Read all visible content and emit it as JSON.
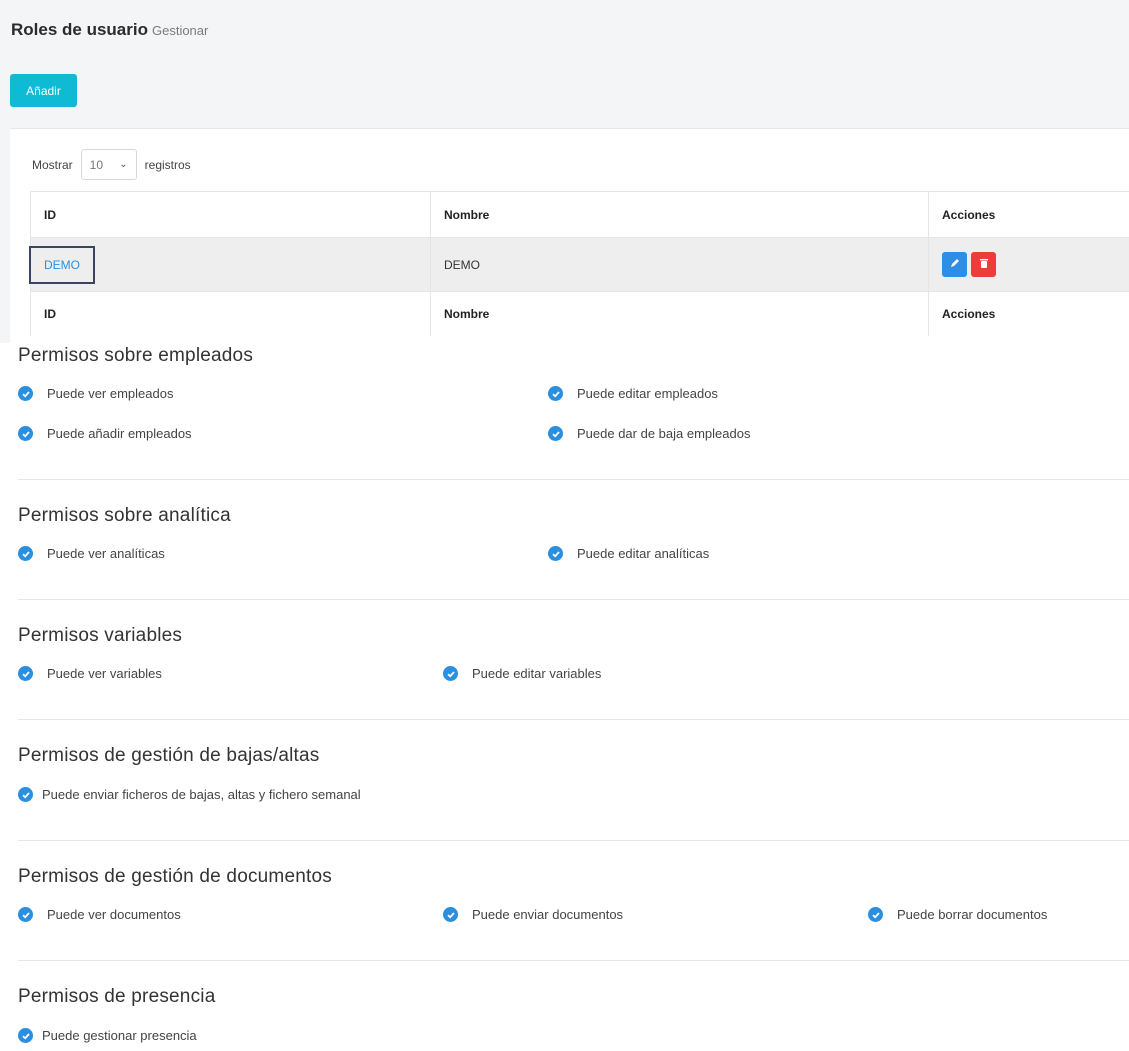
{
  "header": {
    "title": "Roles de usuario",
    "subtitle": "Gestionar"
  },
  "toolbar": {
    "add_label": "Añadir"
  },
  "table": {
    "length_prefix": "Mostrar",
    "length_value": "10",
    "length_suffix": "registros",
    "columns": [
      "ID",
      "Nombre",
      "Acciones"
    ],
    "rows": [
      {
        "id": "DEMO",
        "name": "DEMO"
      }
    ]
  },
  "sections": [
    {
      "title": "Permisos sobre empleados",
      "items": [
        "Puede ver empleados",
        "Puede editar empleados",
        "Puede añadir empleados",
        "Puede dar de baja empleados"
      ]
    },
    {
      "title": "Permisos sobre analítica",
      "items": [
        "Puede ver analíticas",
        "Puede editar analíticas"
      ]
    },
    {
      "title": "Permisos variables",
      "items": [
        "Puede ver variables",
        "Puede editar variables"
      ]
    },
    {
      "title": "Permisos de gestión de bajas/altas",
      "items": [
        "Puede enviar ficheros de bajas, altas y fichero semanal"
      ]
    },
    {
      "title": "Permisos de gestión de documentos",
      "items": [
        "Puede ver documentos",
        "Puede enviar documentos",
        "Puede borrar documentos"
      ]
    },
    {
      "title": "Permisos de presencia",
      "items": [
        "Puede gestionar presencia"
      ]
    }
  ],
  "colors": {
    "accent": "#0fbad4",
    "link": "#2b8fdc",
    "edit": "#2c8ee6",
    "delete": "#f03b3b",
    "check": "#2b8fe0"
  },
  "icons": {
    "check": "check-circle-icon",
    "edit": "pencil-icon",
    "delete": "trash-icon",
    "dropdown": "chevron-down-icon"
  }
}
